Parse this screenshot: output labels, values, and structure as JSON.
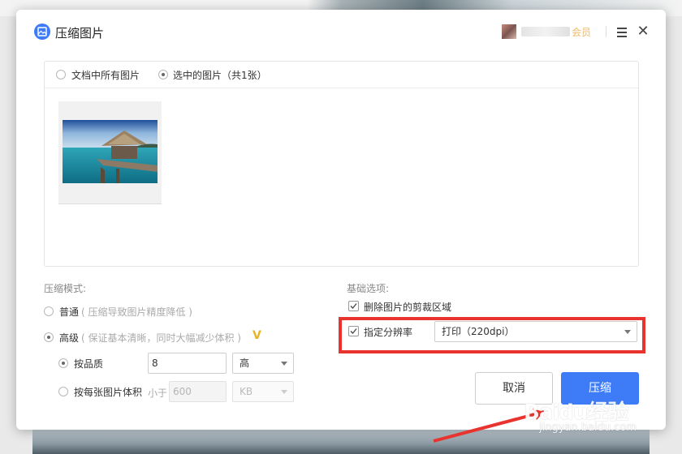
{
  "dialog": {
    "title": "压缩图片",
    "icon": "image-compress-icon",
    "user": {
      "member_label": "会员"
    }
  },
  "scope": {
    "all_images": "文档中所有图片",
    "selected_images": "选中的图片（共1张）",
    "selected": "selected_images"
  },
  "thumbnail": {
    "subject": "overwater-hut-photo",
    "selected": true
  },
  "compress_mode": {
    "section_title": "压缩模式:",
    "normal": {
      "label": "普通",
      "hint": "( 压缩导致图片精度降低 )",
      "selected": false
    },
    "advanced": {
      "label": "高级",
      "hint": "( 保证基本清晰，同时大幅减少体积 )",
      "badge": "V",
      "selected": true
    },
    "by_quality": {
      "label": "按品质",
      "value": "8",
      "level": "高",
      "selected": true
    },
    "by_size": {
      "label": "按每张图片体积",
      "prefix": "小于",
      "value": "600",
      "unit": "KB",
      "selected": false
    }
  },
  "basic_options": {
    "section_title": "基础选项:",
    "remove_crop": {
      "label": "删除图片的剪裁区域",
      "checked": true
    },
    "resolution": {
      "label": "指定分辨率",
      "checked": true,
      "value": "打印（220dpi）"
    }
  },
  "buttons": {
    "cancel": "取消",
    "compress": "压缩"
  },
  "watermark": {
    "brand": "Baidu经验",
    "url": "jingyan.baidu.com"
  },
  "colors": {
    "primary": "#3d7bf7",
    "highlight": "#e8332e",
    "vip": "#e6b422",
    "member": "#e6a23c"
  }
}
